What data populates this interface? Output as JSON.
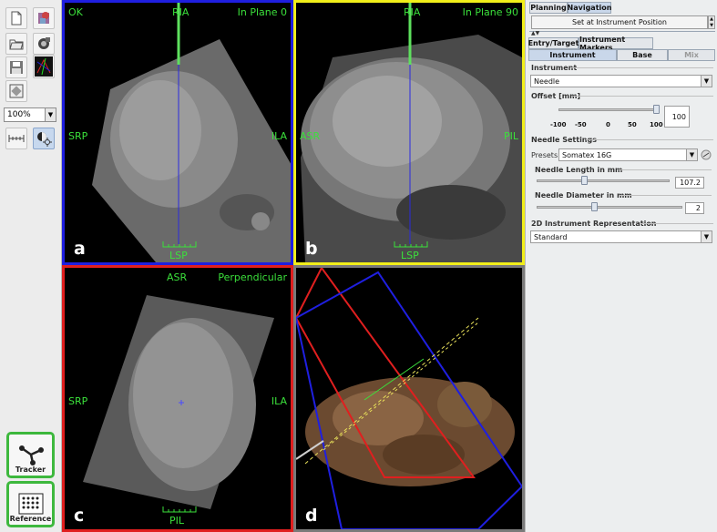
{
  "zoom": {
    "value": "100%"
  },
  "tracker_label": "Tracker",
  "reference_label": "Reference",
  "views": {
    "a": {
      "status": "OK",
      "plane": "In Plane 0",
      "top": "RIA",
      "left": "SRP",
      "right": "ILA",
      "bottom": "LSP",
      "letter": "a"
    },
    "b": {
      "plane": "In Plane 90",
      "top": "RIA",
      "left": "ASR",
      "right": "PIL",
      "bottom": "LSP",
      "letter": "b"
    },
    "c": {
      "plane": "Perpendicular",
      "top": "ASR",
      "left": "SRP",
      "right": "ILA",
      "bottom": "PIL",
      "letter": "c"
    },
    "d": {
      "letter": "d"
    }
  },
  "panel": {
    "top_tabs": [
      "Planning",
      "Navigation"
    ],
    "set_position": "Set at Instrument Position",
    "sub_tabs": [
      "Entry/Target",
      "Instrument Markers"
    ],
    "mode_tabs": [
      "Instrument",
      "Base",
      "Mix"
    ],
    "instrument_label": "Instrument",
    "instrument_value": "Needle",
    "offset_label": "Offset [mm]",
    "offset_ticks": [
      "-100",
      "-50",
      "0",
      "50",
      "100"
    ],
    "offset_value": "100",
    "needle_settings_label": "Needle Settings",
    "presets_label": "Presets:",
    "presets_value": "Somatex 16G",
    "length_label": "Needle Length in mm",
    "length_value": "107.2",
    "diameter_label": "Needle Diameter in mm",
    "diameter_value": "2",
    "repr_label": "2D Instrument Representation",
    "repr_value": "Standard"
  },
  "colors": {
    "view_a": "#1f1fe0",
    "view_b": "#f2ef1a",
    "view_c": "#e01f1f",
    "view_d": "#7a7a7a",
    "label": "#3be03b"
  }
}
